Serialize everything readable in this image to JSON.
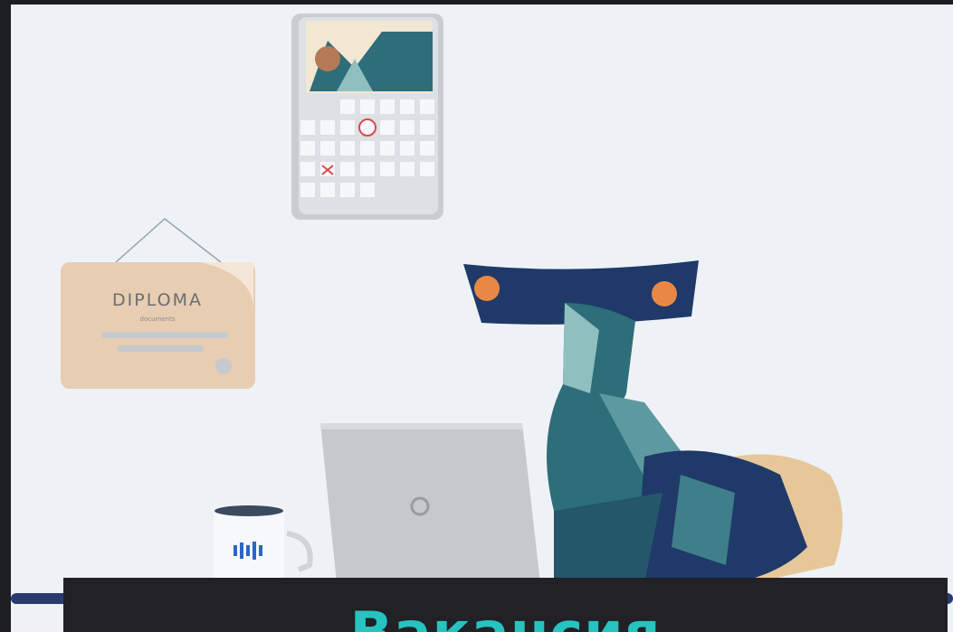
{
  "diploma": {
    "title": "DIPLOMA",
    "subtitle": "documents"
  },
  "caption": {
    "title": "Вакансия"
  },
  "colors": {
    "teal": "#27c3c0",
    "dark_teal": "#2e6d7a",
    "navy": "#1f3a68",
    "paper": "#e7cdb1",
    "background": "#eef2f7"
  }
}
